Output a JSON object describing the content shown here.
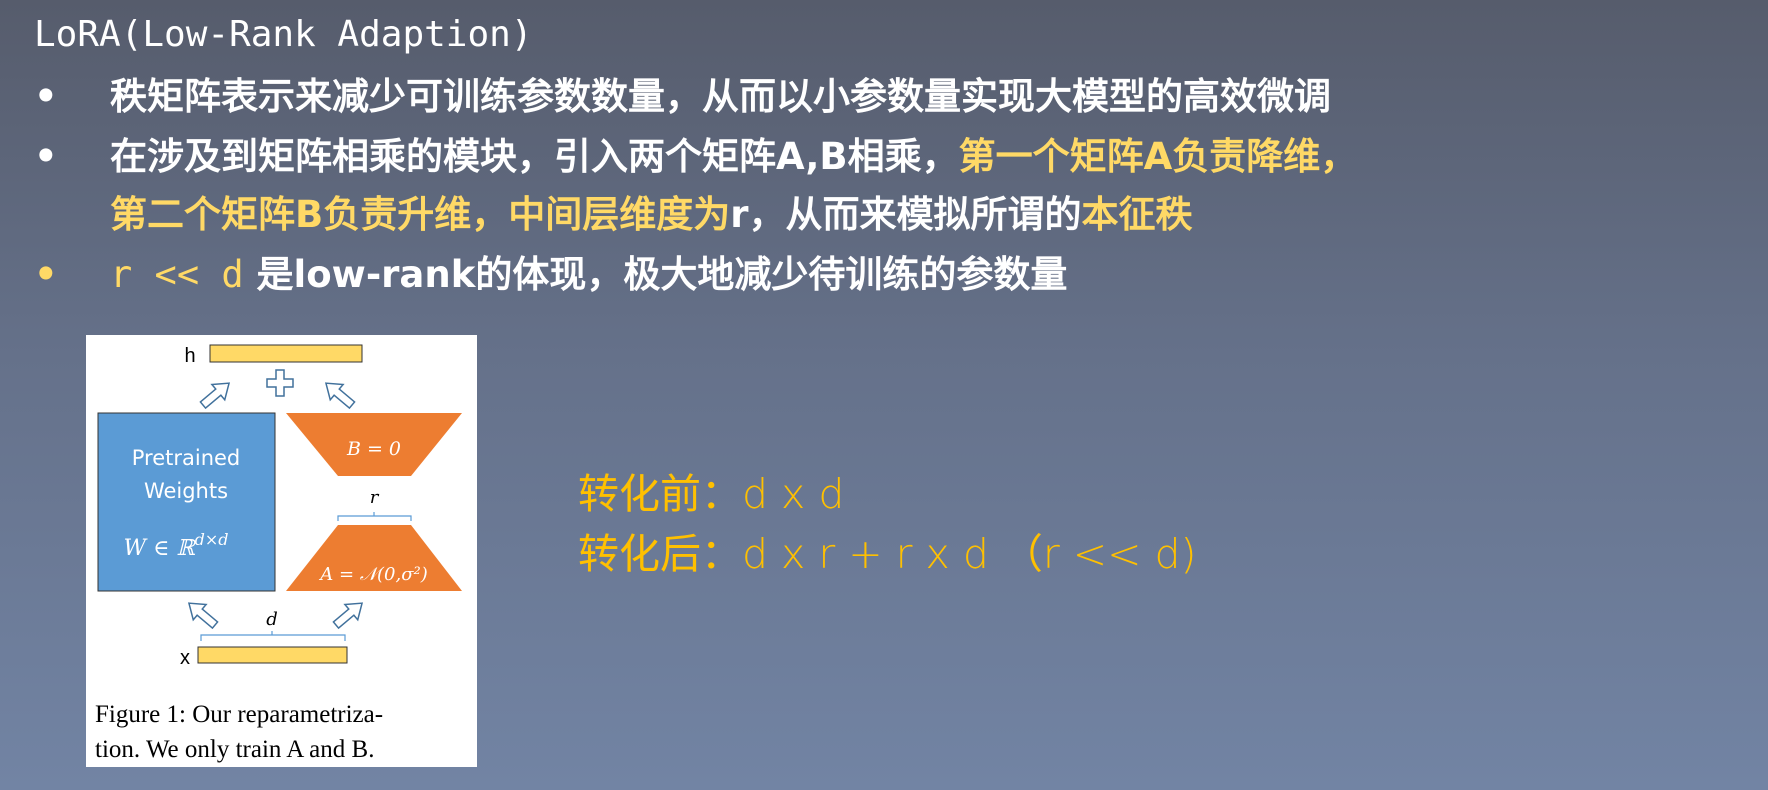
{
  "slide": {
    "title": "LoRA(Low-Rank Adaption)",
    "bullets": [
      {
        "text": "秩矩阵表示来减少可训练参数数量，从而以小参数量实现大模型的高效微调"
      },
      {
        "text_a": "在涉及到矩阵相乘的模块，引入两个矩阵A,B相乘，",
        "text_b": "第一个矩阵A负责降维，",
        "text_c": "第二个矩阵B负责升维，中间层维度为",
        "text_d": "r",
        "text_e": "，从而来模拟所谓的",
        "text_f": "本征秩"
      },
      {
        "text_a": "r << d",
        "text_b": " 是low-rank的体现，极大地减少待训练的参数量"
      }
    ],
    "bullet_symbol": "•",
    "colors": {
      "highlight": "#ffd966",
      "formula": "#ffc000",
      "text": "#ffffff"
    }
  },
  "figure": {
    "h_label": "h",
    "x_label": "x",
    "pretrained_line1": "Pretrained",
    "pretrained_line2": "Weights",
    "w_formula": "W ∈ ℝ",
    "w_sup": "d×d",
    "b_label": "B = 0",
    "a_label": "A = 𝒩(0,σ²)",
    "r_label": "r",
    "d_label": "d",
    "caption_line1": "Figure 1: Our reparametriza-",
    "caption_line2": "tion. We only train A and B.",
    "colors": {
      "pretrained": "#5b9bd5",
      "lora": "#ed7d31",
      "vector": "#ffd966"
    }
  },
  "formulas": {
    "before": "转化前：d x d",
    "after": "转化后：d x r + r x d （r << d)"
  }
}
